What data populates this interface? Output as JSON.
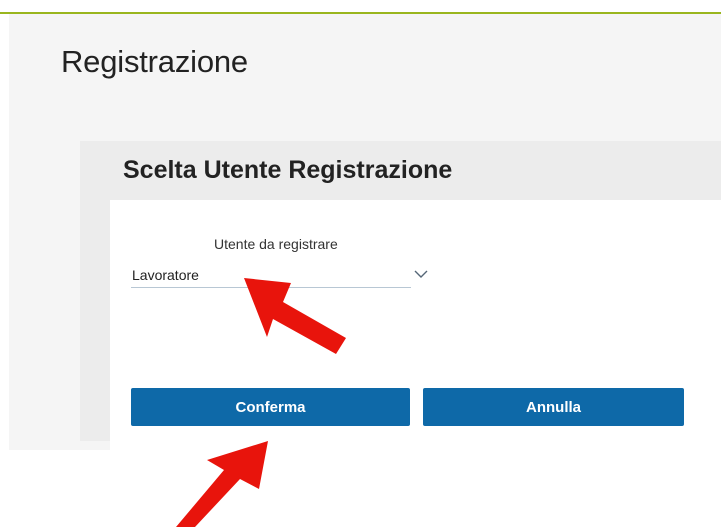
{
  "page": {
    "title": "Registrazione"
  },
  "card": {
    "title": "Scelta Utente Registrazione"
  },
  "form": {
    "user_type_label": "Utente da registrare",
    "user_type_value": "Lavoratore"
  },
  "buttons": {
    "confirm_label": "Conferma",
    "cancel_label": "Annulla"
  },
  "icons": {
    "dropdown": "chevron-down-icon",
    "annotation": "red-arrow"
  },
  "colors": {
    "accent_line": "#9ab61e",
    "primary_button": "#0e69a8",
    "annotation_arrow": "#e8140c"
  }
}
